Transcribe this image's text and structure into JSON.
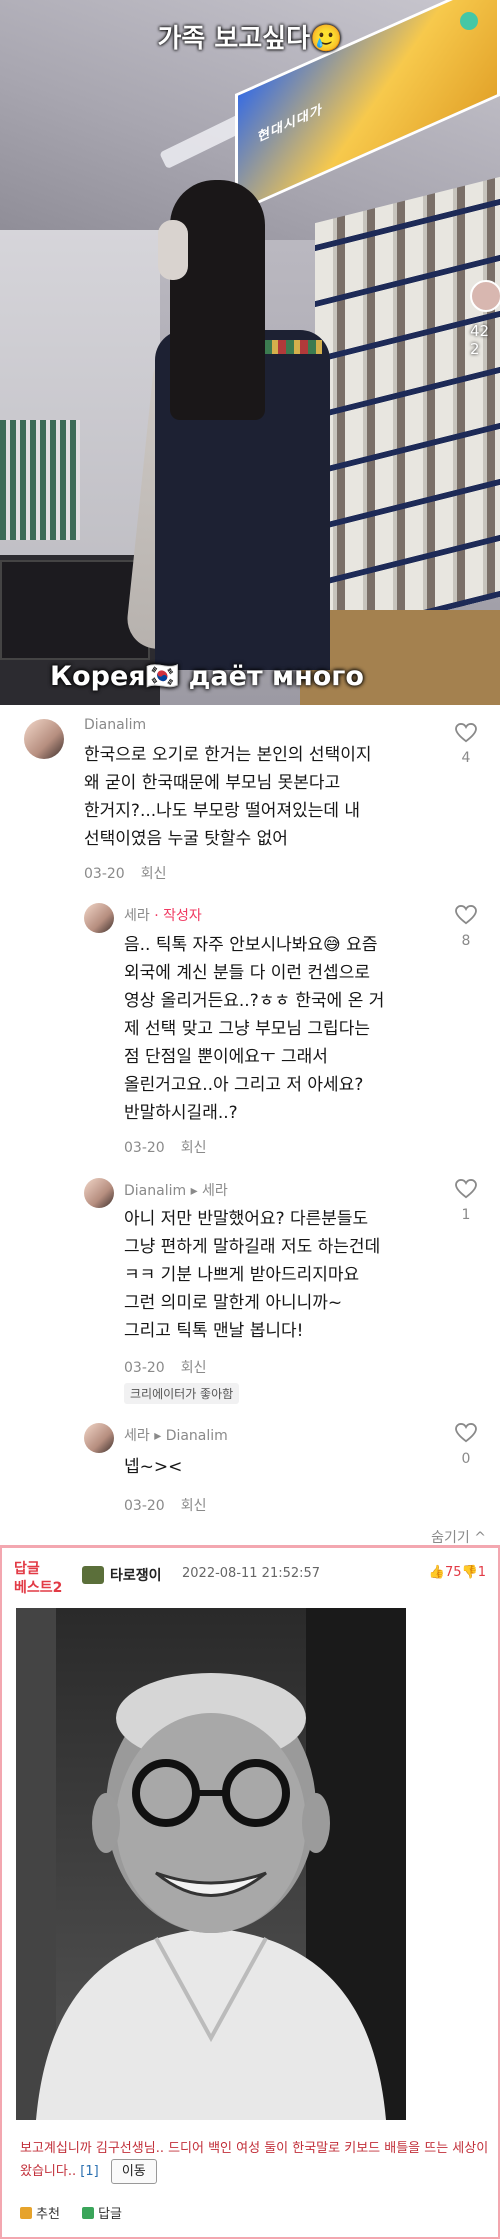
{
  "video": {
    "headline": "가족 보고싶다🥲",
    "caption": "Корея🇰🇷 даёт много",
    "sign_text": "현대시대가",
    "side_counts": [
      "42",
      "2"
    ]
  },
  "comments": [
    {
      "name": "Dianalim",
      "text_lines": [
        "한국으로 오기로 한거는 본인의 선택이지",
        "왜 굳이 한국때문에 부모님 못본다고",
        "한거지?...나도 부모랑 떨어져있는데 내",
        "선택이였음 누굴 탓할수 없어"
      ],
      "date": "03-20",
      "reply_label": "회신",
      "likes": "4"
    },
    {
      "name": "세라",
      "author_tag": "· 작성자",
      "text_lines": [
        "음.. 틱톡 자주 안보시나봐요😅 요즘",
        "외국에 계신 분들 다 이런 컨셉으로",
        "영상 올리거든요..?ㅎㅎ 한국에 온 거",
        "제 선택 맞고 그냥 부모님 그립다는",
        "점 단점일 뿐이에요ㅜ 그래서",
        "올린거고요..아 그리고 저 아세요?",
        "반말하시길래..?"
      ],
      "date": "03-20",
      "reply_label": "회신",
      "likes": "8"
    },
    {
      "name": "Dianalim ▸ 세라",
      "text_lines": [
        "아니 저만 반말했어요? 다른분들도",
        "그냥 편하게 말하길래 저도 하는건데",
        "ㅋㅋ 기분 나쁘게 받아드리지마요",
        "그런 의미로 말한게 아니니까~",
        "그리고 틱톡 맨날 봅니다!"
      ],
      "date": "03-20",
      "reply_label": "회신",
      "creator_liked": "크리에이터가 좋아함",
      "likes": "1"
    },
    {
      "name": "세라 ▸ Dianalim",
      "text_lines": [
        "넵~><"
      ],
      "date": "03-20",
      "reply_label": "회신",
      "likes": "0"
    }
  ],
  "hide_replies": "숨기기 ^",
  "board": {
    "best_tag_line1": "답글",
    "best_tag_line2": "베스트2",
    "writer": "타로쟁이",
    "timestamp": "2022-08-11 21:52:57",
    "votes": "👍75👎1",
    "text": "보고계십니까 김구선생님.. 드디어 백인 여성 둘이 한국말로 키보드 배틀을 뜨는 세상이 왔습니다..",
    "reply_count": "[1]",
    "move_button": "이동",
    "recommend_label": "추천",
    "reply_label": "답글"
  },
  "colors": {
    "author": "#f03a62",
    "board_border": "#f3a7b0",
    "board_text": "#c2303a"
  }
}
